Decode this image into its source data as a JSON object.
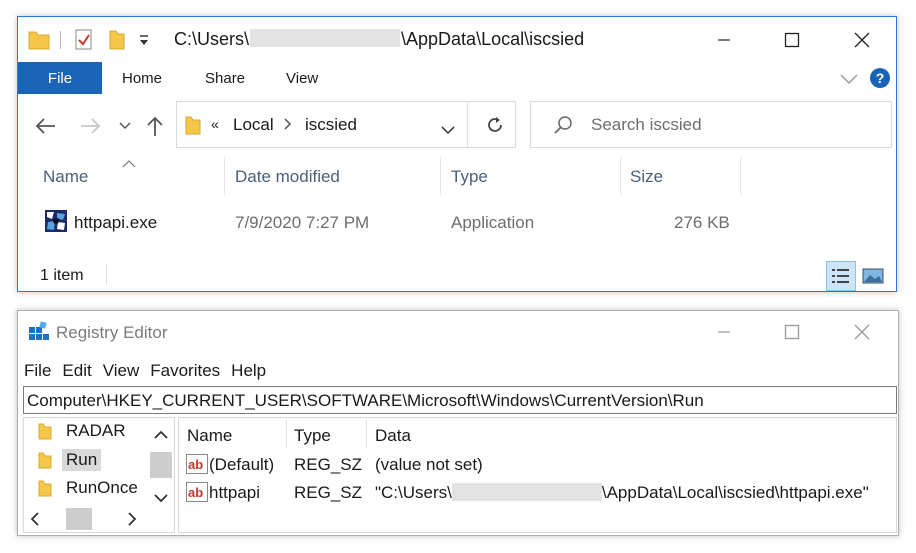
{
  "explorer": {
    "title_prefix": "C:\\Users\\",
    "title_suffix": "\\AppData\\Local\\iscsied",
    "ribbon_tabs": [
      "File",
      "Home",
      "Share",
      "View"
    ],
    "help": "?",
    "address": {
      "overflow": "«",
      "segments": [
        "Local",
        "iscsied"
      ]
    },
    "search_placeholder": "Search iscsied",
    "columns": [
      "Name",
      "Date modified",
      "Type",
      "Size"
    ],
    "files": [
      {
        "name": "httpapi.exe",
        "date": "7/9/2020 7:27 PM",
        "type": "Application",
        "size": "276 KB"
      }
    ],
    "status": "1 item"
  },
  "regedit": {
    "title": "Registry Editor",
    "menu": [
      "File",
      "Edit",
      "View",
      "Favorites",
      "Help"
    ],
    "path": "Computer\\HKEY_CURRENT_USER\\SOFTWARE\\Microsoft\\Windows\\CurrentVersion\\Run",
    "tree": [
      {
        "label": "RADAR",
        "selected": false
      },
      {
        "label": "Run",
        "selected": true
      },
      {
        "label": "RunOnce",
        "selected": false
      }
    ],
    "columns": [
      "Name",
      "Type",
      "Data"
    ],
    "values": [
      {
        "name": "(Default)",
        "type": "REG_SZ",
        "data": "(value not set)"
      },
      {
        "name": "httpapi",
        "type": "REG_SZ",
        "data_prefix": "\"C:\\Users\\",
        "data_suffix": "\\AppData\\Local\\iscsied\\httpapi.exe\""
      }
    ]
  },
  "colors": {
    "accent": "#1a64b7",
    "folder": "#f5c749",
    "header_text": "#4c607a",
    "icon_red": "#c0392b"
  }
}
